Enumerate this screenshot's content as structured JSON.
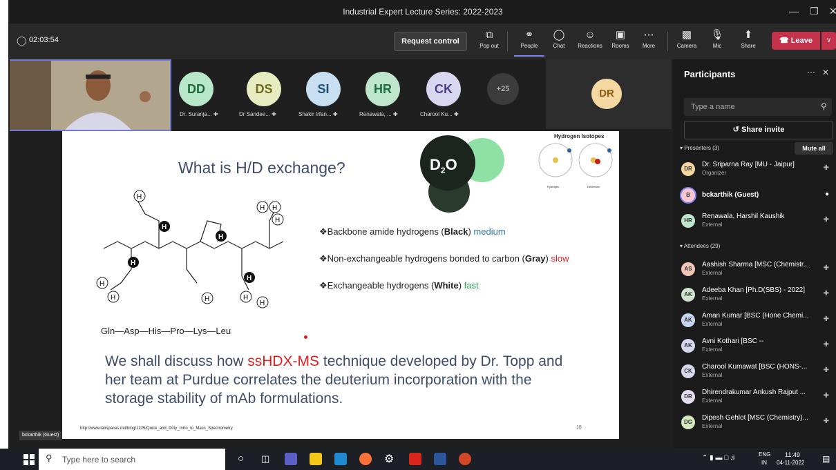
{
  "window": {
    "title": "Industrial Expert Lecture Series: 2022-2023"
  },
  "toolbar": {
    "timer": "02:03:54",
    "request_control": "Request control",
    "buttons": [
      {
        "label": "Pop out",
        "icon": "popout-icon"
      },
      {
        "label": "People",
        "icon": "people-icon"
      },
      {
        "label": "Chat",
        "icon": "chat-icon"
      },
      {
        "label": "Reactions",
        "icon": "reactions-icon"
      },
      {
        "label": "Rooms",
        "icon": "rooms-icon"
      },
      {
        "label": "More",
        "icon": "more-icon"
      },
      {
        "label": "Camera",
        "icon": "camera-off-icon"
      },
      {
        "label": "Mic",
        "icon": "mic-off-icon"
      },
      {
        "label": "Share",
        "icon": "share-icon"
      }
    ],
    "leave": "Leave"
  },
  "gallery": {
    "participants": [
      {
        "initials": "DD",
        "name": "Dr. Suranja...",
        "color": "#b8e6c8"
      },
      {
        "initials": "DS",
        "name": "Dr Sandee...",
        "color": "#e6ecc0"
      },
      {
        "initials": "SI",
        "name": "Shakir Irfan...",
        "color": "#c7dff0"
      },
      {
        "initials": "HR",
        "name": "Renawala, ...",
        "color": "#bfe6cc"
      },
      {
        "initials": "CK",
        "name": "Charool Ku...",
        "color": "#d9d6f0"
      }
    ],
    "overflow": "+25",
    "large_tile": {
      "initials": "DR",
      "color": "#f4d7a1"
    }
  },
  "slide": {
    "title": "What is H/D exchange?",
    "molecule_label": "D",
    "molecule_sub": "2",
    "molecule_label2": "O",
    "isotopes_title": "Hydrogen Isotopes",
    "isotope_labels": [
      "Hydrogen",
      "Deuterium"
    ],
    "peptide_chain": "Gln—Asp—His—Pro—Lys—Leu",
    "bullets": [
      {
        "prefix": "❖Backbone amide hydrogens (",
        "bold": "Black",
        "mid": ") ",
        "rate": "medium",
        "rate_color": "#2e75b6"
      },
      {
        "prefix": "❖Non-exchangeable hydrogens bonded to carbon (",
        "bold": "Gray",
        "mid": ") ",
        "rate": "slow",
        "rate_color": "#e02020"
      },
      {
        "prefix": "❖Exchangeable hydrogens (",
        "bold": "White",
        "mid": ") ",
        "rate": "fast",
        "rate_color": "#2aa84a"
      }
    ],
    "paragraph_pre": "We shall discuss how ",
    "paragraph_highlight": "ssHDX-MS",
    "paragraph_post": " technique developed by Dr. Topp and her team at Purdue correlates the deuterium incorporation with the storage stability of mAb formulations.",
    "url": "http://www.labspaces.net/blog/1225/Quick_and_Dirty_Intro_to_Mass_Spectrometry",
    "page_number": "18"
  },
  "presenter_tag": "bckarthik (Guest)",
  "panel": {
    "title": "Participants",
    "search_placeholder": "Type a name",
    "share_invite": "Share invite",
    "presenters_header": "Presenters (3)",
    "mute_all": "Mute all",
    "presenters": [
      {
        "initials": "DR",
        "name": "Dr. Sriparna Ray [MU - Jaipur]",
        "sub": "Organizer",
        "color": "#f4d7a1"
      },
      {
        "initials": "B",
        "name": "bckarthik (Guest)",
        "sub": "",
        "color": "#f7c6d0"
      },
      {
        "initials": "HR",
        "name": "Renawala, Harshil Kaushik",
        "sub": "External",
        "color": "#bfe6cc"
      }
    ],
    "attendees_header": "Attendees (29)",
    "attendees": [
      {
        "initials": "AS",
        "name": "Aashish Sharma [MSC (Chemistr...",
        "sub": "External",
        "color": "#f2c7b8"
      },
      {
        "initials": "AK",
        "name": "Adeeba Khan [Ph.D(SBS) - 2022]",
        "sub": "External",
        "color": "#cfe3cf"
      },
      {
        "initials": "AK",
        "name": "Aman Kumar [BSC (Hone Chemi...",
        "sub": "External",
        "color": "#c7d6f0"
      },
      {
        "initials": "AK",
        "name": "Avni Kothari [BSC --",
        "sub": "External",
        "color": "#d9d6f0"
      },
      {
        "initials": "CK",
        "name": "Charool Kumawat [BSC (HONS-...",
        "sub": "External",
        "color": "#d9d6f0"
      },
      {
        "initials": "DR",
        "name": "Dhirendrakumar Ankush Rajput ...",
        "sub": "External",
        "color": "#e4dcef"
      },
      {
        "initials": "DG",
        "name": "Dipesh Gehlot [MSC (Chemistry)...",
        "sub": "External",
        "color": "#d4e8c0"
      }
    ]
  },
  "taskbar": {
    "search_placeholder": "Type here to search",
    "lang": "ENG",
    "region": "IN",
    "time": "11:49",
    "date": "04-11-2022"
  }
}
